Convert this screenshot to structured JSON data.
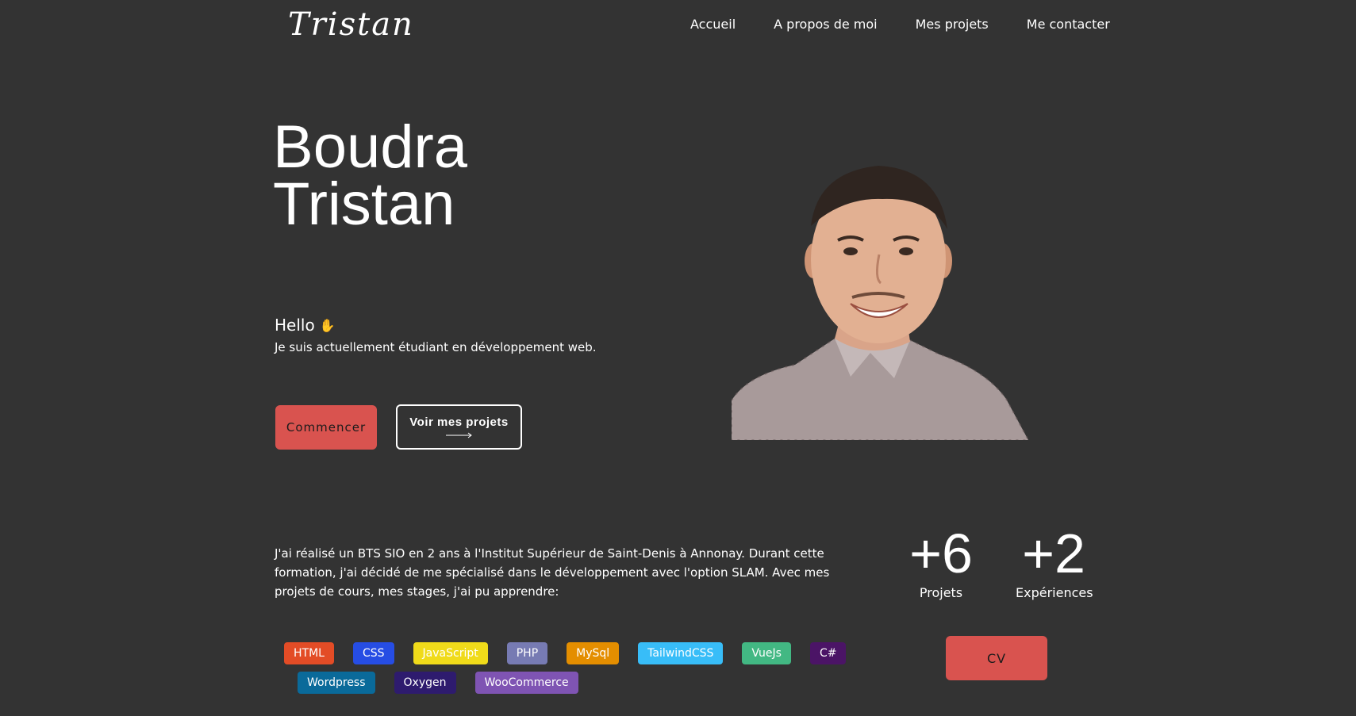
{
  "header": {
    "logo": "Tristan",
    "nav": [
      {
        "label": "Accueil"
      },
      {
        "label": "A propos de moi"
      },
      {
        "label": "Mes projets"
      },
      {
        "label": "Me contacter"
      }
    ]
  },
  "hero": {
    "first_name_line": "Boudra",
    "last_name_line": "Tristan",
    "greeting": "Hello",
    "greeting_icon": "waving-hand-icon",
    "subtitle": "Je suis actuellement étudiant en développement web.",
    "start_button": "Commencer",
    "projects_button": "Voir mes projets",
    "portrait_icon": "portrait-photo"
  },
  "about": {
    "bio": "J'ai réalisé un BTS SIO en 2 ans à l'Institut Supérieur de Saint-Denis à Annonay. Durant cette formation, j'ai décidé de me spécialisé dans le développement avec l'option SLAM. Avec mes projets de cours, mes stages, j'ai pu apprendre:",
    "stats": [
      {
        "value": "+6",
        "label": "Projets"
      },
      {
        "value": "+2",
        "label": "Expériences"
      }
    ],
    "skills_row1": [
      {
        "label": "HTML",
        "color": "#e34c26"
      },
      {
        "label": "CSS",
        "color": "#264de4"
      },
      {
        "label": "JavaScript",
        "color": "#f0db1a"
      },
      {
        "label": "PHP",
        "color": "#777bb3"
      },
      {
        "label": "MySql",
        "color": "#e48e00"
      },
      {
        "label": "TailwindCSS",
        "color": "#38bdf8"
      },
      {
        "label": "VueJs",
        "color": "#42b883"
      },
      {
        "label": "C#",
        "color": "#4b1466"
      }
    ],
    "skills_row2": [
      {
        "label": "Wordpress",
        "color": "#0a6a9a"
      },
      {
        "label": "Oxygen",
        "color": "#2e1b6e"
      },
      {
        "label": "WooCommerce",
        "color": "#7f54b3"
      }
    ],
    "cv_button": "CV"
  },
  "colors": {
    "background": "#333333",
    "accent": "#d9534f",
    "text": "#ffffff"
  }
}
